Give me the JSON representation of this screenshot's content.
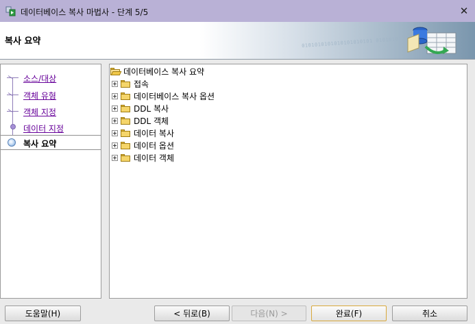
{
  "window": {
    "title": "데이터베이스 복사 마법사 - 단계 5/5",
    "close_glyph": "✕"
  },
  "header": {
    "title": "복사 요약",
    "binary_text": "0101010101010101010101 01010101"
  },
  "nav": {
    "items": [
      {
        "label": "소스/대상",
        "state": "visited"
      },
      {
        "label": "객체 유형",
        "state": "visited"
      },
      {
        "label": "객체 지정",
        "state": "visited"
      },
      {
        "label": "데이터 지정",
        "state": "visited"
      },
      {
        "label": "복사 요약",
        "state": "current"
      }
    ]
  },
  "tree": {
    "root": "데이터베이스 복사 요약",
    "children": [
      "접속",
      "데이터베이스 복사 옵션",
      "DDL 복사",
      "DDL 객체",
      "데이터 복사",
      "데이터 옵션",
      "데이터 객체"
    ]
  },
  "buttons": {
    "help": "도움말(H)",
    "back": "< 뒤로(B)",
    "next": "다음(N) >",
    "finish": "완료(F)",
    "cancel": "취소"
  },
  "colors": {
    "title_bar": "#b9b1d6",
    "visited_link": "#660099"
  }
}
